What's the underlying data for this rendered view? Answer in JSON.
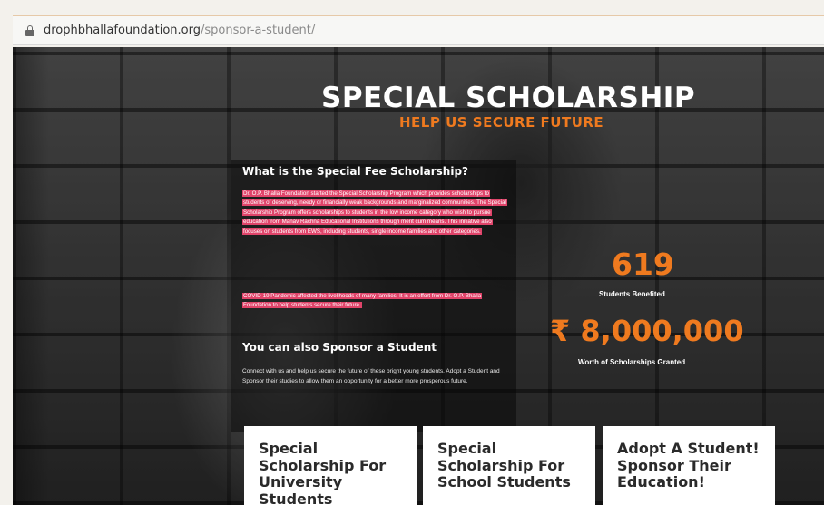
{
  "browser": {
    "url_domain": "drophbhallafoundation.org",
    "url_path": "/sponsor-a-student/"
  },
  "hero": {
    "title": "SPECIAL SCHOLARSHIP",
    "subtitle": "HELP US SECURE FUTURE"
  },
  "about": {
    "heading": "What is the Special Fee Scholarship?",
    "paragraph_one": "Dr. O.P. Bhalla Foundation started the Special Scholarship Program which provides scholarships to students of deserving, needy or financially weak backgrounds and marginalized communities. The Special Scholarship Program offers scholarships to students in the low income category who wish to pursue education from Manav Rachna Educational Institutions through merit cum means. This initiative also focuses on students from EWS, including students, single income families and other categories.",
    "paragraph_two": "COVID-19 Pandemic affected the livelihoods of many families. It is an effort from Dr. O.P. Bhalla Foundation to help students secure their future."
  },
  "sponsor": {
    "heading": "You can also Sponsor a Student",
    "text": "Connect with us and help us secure the future of these bright young students. Adopt a Student and Sponsor their studies to allow them an opportunity for a better more prosperous future."
  },
  "stats": {
    "students_value": "619",
    "students_label": "Students Benefited",
    "amount_value": "₹ 8,000,000",
    "amount_label": "Worth of Scholarships Granted"
  },
  "cards": [
    {
      "title": "Special Scholarship For University Students"
    },
    {
      "title": "Special Scholarship For School Students"
    },
    {
      "title": "Adopt A Student! Sponsor Their Education!"
    }
  ],
  "colors": {
    "accent_orange": "#ef7a1f",
    "highlight_pink": "#e0446a"
  }
}
